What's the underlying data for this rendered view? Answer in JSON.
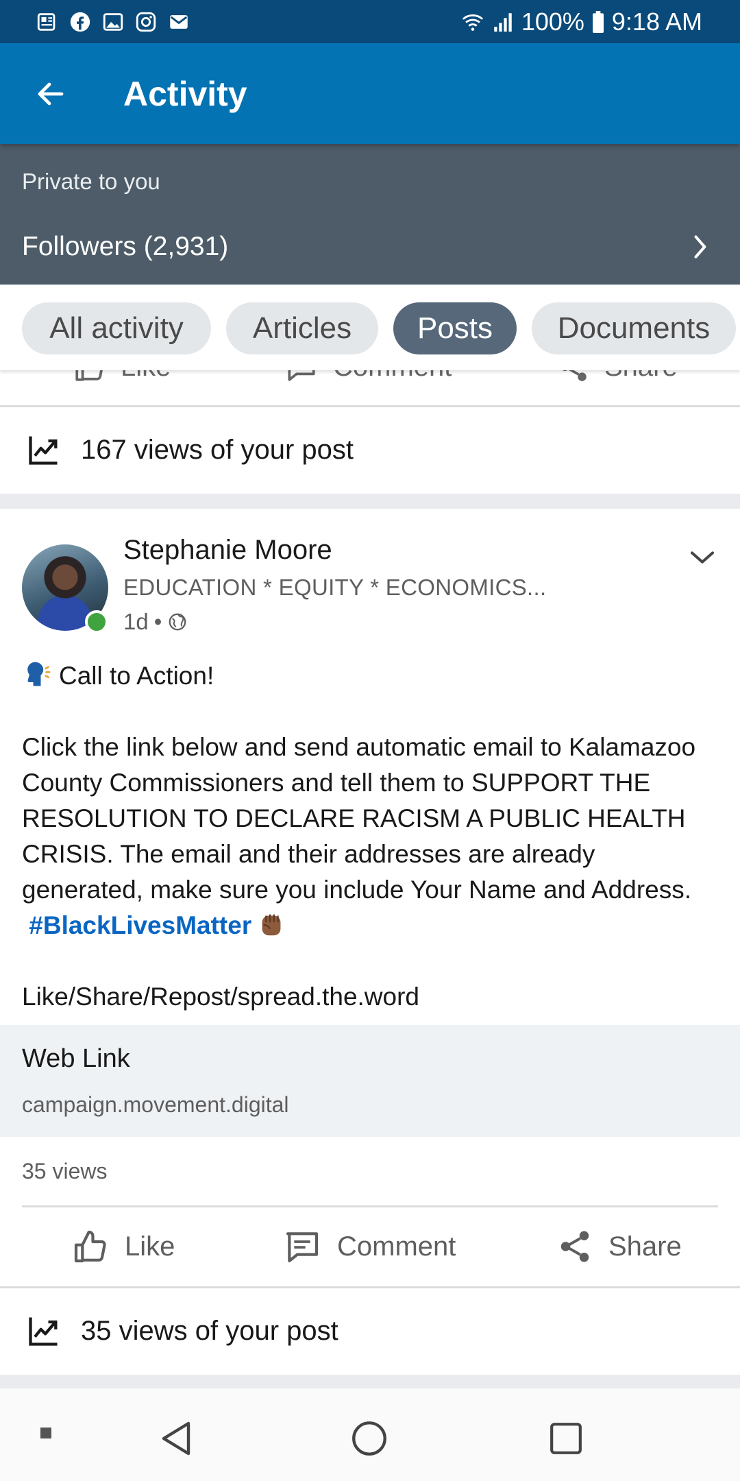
{
  "status_bar": {
    "battery": "100%",
    "time": "9:18 AM",
    "left_icons": [
      "news-icon",
      "facebook-icon",
      "gallery-icon",
      "instagram-icon",
      "mail-icon"
    ],
    "right_icons": [
      "wifi-icon",
      "signal-icon",
      "battery-icon"
    ]
  },
  "app_bar": {
    "title": "Activity",
    "color": "#0473b3"
  },
  "private_banner": {
    "label": "Private to you",
    "followers": "Followers (2,931)"
  },
  "filters": {
    "chips": [
      "All activity",
      "Articles",
      "Posts",
      "Documents"
    ],
    "selected": "Posts"
  },
  "previous_post": {
    "actions": [
      "Like",
      "Comment",
      "Share"
    ],
    "views_text": "167 views of your post"
  },
  "post": {
    "author": "Stephanie Moore",
    "headline": "EDUCATION * EQUITY * ECONOMICS...",
    "age": "1d",
    "separator": "•",
    "visibility_icon": "globe-icon",
    "line1": "Call to Action!",
    "paragraph": "Click the link below and send automatic email to Kalamazoo County Commissioners and tell them to SUPPORT THE RESOLUTION TO DECLARE RACISM A PUBLIC HEALTH CRISIS. The email and their addresses are already generated, make sure you include Your Name and Address.",
    "hashtag": "#BlackLivesMatter",
    "closing": "Like/Share/Repost/spread.the.word",
    "web_link": {
      "title": "Web Link",
      "url": "campaign.movement.digital"
    },
    "views": "35 views",
    "actions": {
      "like": "Like",
      "comment": "Comment",
      "share": "Share"
    },
    "views_text": "35 views of your post"
  },
  "nav_bar": {
    "buttons": [
      "recent-dot-icon",
      "back-triangle-icon",
      "home-circle-icon",
      "overview-square-icon"
    ]
  }
}
